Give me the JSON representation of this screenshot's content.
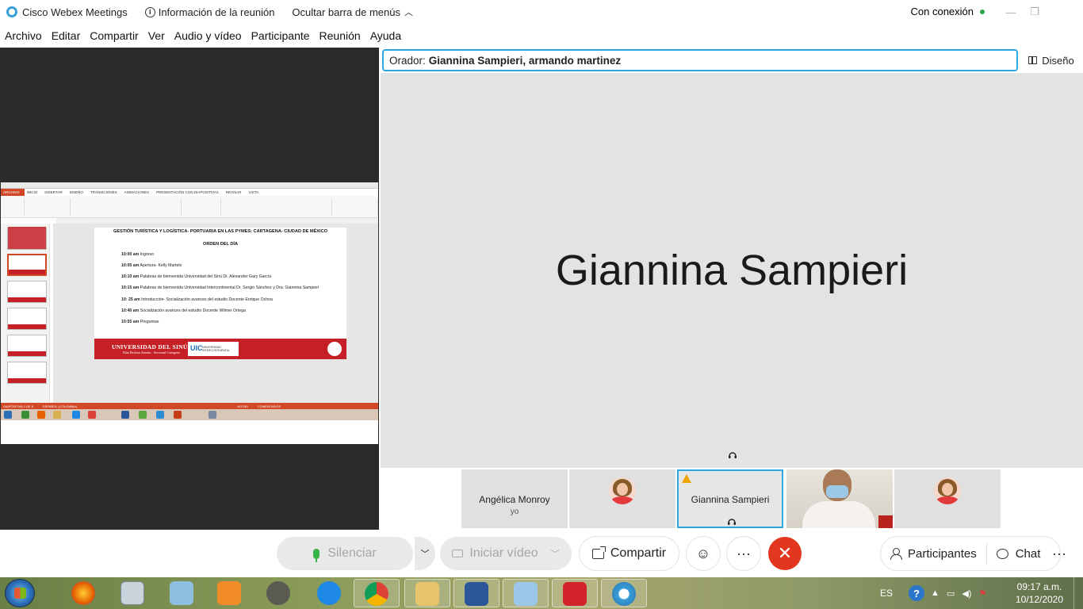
{
  "window": {
    "app_title": "Cisco Webex Meetings",
    "meeting_info": "Información de la reunión",
    "hide_menu": "Ocultar barra de menús",
    "connection_status": "Con conexión"
  },
  "menu": [
    "Archivo",
    "Editar",
    "Compartir",
    "Ver",
    "Audio y vídeo",
    "Participante",
    "Reunión",
    "Ayuda"
  ],
  "shared_screen": {
    "ppt_tabs": [
      "ARCHIVO",
      "INICIO",
      "INSERTAR",
      "DISEÑO",
      "TRANSICIONES",
      "ANIMACIONES",
      "PRESENTACIÓN CON DIAPOSITIVAS",
      "REVISAR",
      "VISTA"
    ],
    "slide_title": "GESTIÓN TURÍSTICA Y LOGÍSTICA- PORTUARIA EN LAS PYMES: CARTAGENA- CIUDAD DE MÉXICO",
    "slide_subtitle": "ORDEN DEL DÍA",
    "agenda": [
      {
        "time": "10:00 am",
        "text": "Ingreso"
      },
      {
        "time": "10:05 am",
        "text": "Apertura- Kelly Martelo"
      },
      {
        "time": "10:10 am",
        "text": "Palabras de bienvenida Universidad del Sinú Dr. Alexander Gary García"
      },
      {
        "time": "10:15 am",
        "text": "Palabras de bienvenida Universidad Intercontinental Dr. Sergio Sánchez y Dra. Giannina Sampieri"
      },
      {
        "time": "10: 25 am",
        "text": "Introducción- Socialización avances del estudio Docente Enrique Ochoa"
      },
      {
        "time": "10:40 am",
        "text": "Socialización avances del estudio Docente Wilmer Ortega"
      },
      {
        "time": "10:55 am",
        "text": "Preguntas"
      }
    ],
    "university_name": "UNIVERSIDAD DEL SINÚ",
    "university_sub": "Elías Bechara Zainúm · Seccional Cartagena",
    "uic_logo": "UIC",
    "uic_text": "UNIVERSIDAD INTERCONTINENTAL",
    "status_slide": "DIAPOSITIVA 2 DE 8",
    "status_lang": "ESPAÑOL (COLOMBIA)",
    "status_notes": "NOTAS",
    "status_comments": "COMENTARIOS"
  },
  "speaker": {
    "label": "Orador:",
    "names": "Giannina Sampieri, armando martinez",
    "layout_button": "Diseño"
  },
  "stage": {
    "active_name": "Giannina Sampieri"
  },
  "participants": [
    {
      "name": "Angélica Monroy",
      "sub": "yo",
      "type": "name"
    },
    {
      "name": "",
      "sub": "",
      "type": "avatar"
    },
    {
      "name": "Giannina Sampieri",
      "sub": "",
      "type": "active"
    },
    {
      "name": "",
      "sub": "",
      "type": "video"
    },
    {
      "name": "",
      "sub": "",
      "type": "avatar"
    }
  ],
  "controls": {
    "mute": "Silenciar",
    "video": "Iniciar vídeo",
    "share": "Compartir",
    "participants": "Participantes",
    "chat": "Chat"
  },
  "taskbar": {
    "lang": "ES",
    "time": "09:17 a.m.",
    "date": "10/12/2020"
  }
}
